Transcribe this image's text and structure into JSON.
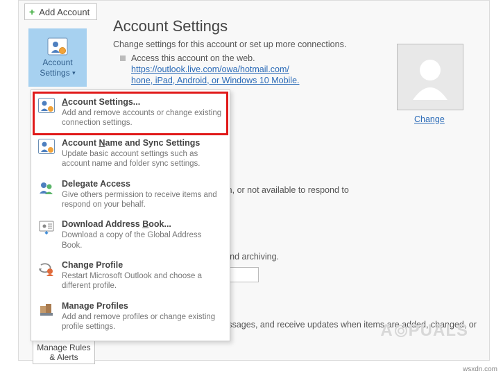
{
  "toolbar": {
    "add_account_label": "Add Account"
  },
  "ribbon": {
    "account_settings_line1": "Account",
    "account_settings_line2": "Settings"
  },
  "page": {
    "title": "Account Settings",
    "subtitle": "Change settings for this account or set up more connections.",
    "web_access_label": "Access this account on the web.",
    "web_url": "https://outlook.live.com/owa/hotmail.com/",
    "mobile_fragment": "hone, iPad, Android, or Windows 10 Mobile.",
    "change_label": "Change",
    "bg_auto_replies": "others that you are on vacation, or not available to respond to",
    "bg_mailbox": "x by emptying Deleted Items and archiving.",
    "bg_rules": "anize your incoming email messages, and receive updates when items are added, changed, or removed.",
    "rules_label_line1": "Manage Rules",
    "rules_label_line2": "& Alerts"
  },
  "menu": [
    {
      "title": "Account Settings...",
      "accel": "A",
      "desc": "Add and remove accounts or change existing connection settings."
    },
    {
      "title": "Account Name and Sync Settings",
      "accel": "N",
      "desc": "Update basic account settings such as account name and folder sync settings."
    },
    {
      "title": "Delegate Access",
      "accel": "",
      "desc": "Give others permission to receive items and respond on your behalf."
    },
    {
      "title": "Download Address Book...",
      "accel": "B",
      "desc": "Download a copy of the Global Address Book."
    },
    {
      "title": "Change Profile",
      "accel": "",
      "desc": "Restart Microsoft Outlook and choose a different profile."
    },
    {
      "title": "Manage Profiles",
      "accel": "",
      "desc": "Add and remove profiles or change existing profile settings."
    }
  ],
  "watermark": {
    "text_pre": "A",
    "text_post": "PUALS"
  },
  "attribution": "wsxdn.com"
}
